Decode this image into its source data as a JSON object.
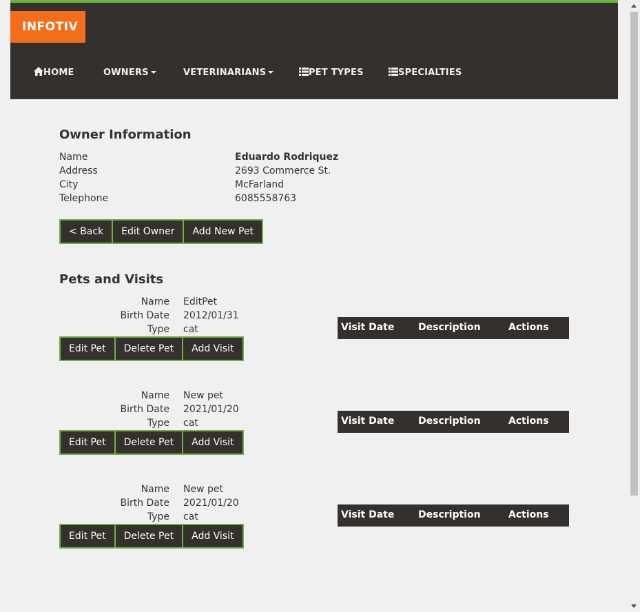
{
  "brand": "INFOTIV",
  "nav": {
    "home": "HOME",
    "owners": "OWNERS",
    "veterinarians": "VETERINARIANS",
    "pet_types": "PET TYPES",
    "specialties": "SPECIALTIES"
  },
  "owner": {
    "heading": "Owner Information",
    "labels": {
      "name": "Name",
      "address": "Address",
      "city": "City",
      "telephone": "Telephone"
    },
    "values": {
      "name": "Eduardo Rodriquez",
      "address": "2693 Commerce St.",
      "city": "McFarland",
      "telephone": "6085558763"
    },
    "buttons": {
      "back": "< Back",
      "edit": "Edit Owner",
      "add_pet": "Add New Pet"
    }
  },
  "pets_heading": "Pets and Visits",
  "pet_labels": {
    "name": "Name",
    "birth_date": "Birth Date",
    "type": "Type"
  },
  "pet_buttons": {
    "edit": "Edit Pet",
    "delete": "Delete Pet",
    "add_visit": "Add Visit"
  },
  "visit_columns": {
    "date": "Visit Date",
    "description": "Description",
    "actions": "Actions"
  },
  "pets": [
    {
      "name": "EditPet",
      "birth_date": "2012/01/31",
      "type": "cat"
    },
    {
      "name": "New pet",
      "birth_date": "2021/01/20",
      "type": "cat"
    },
    {
      "name": "New pet",
      "birth_date": "2021/01/20",
      "type": "cat"
    }
  ],
  "colors": {
    "nav_bg": "#34302d",
    "accent_green": "#6db33f",
    "brand_orange": "#f26e1b",
    "page_bg": "#f0f0f0"
  }
}
